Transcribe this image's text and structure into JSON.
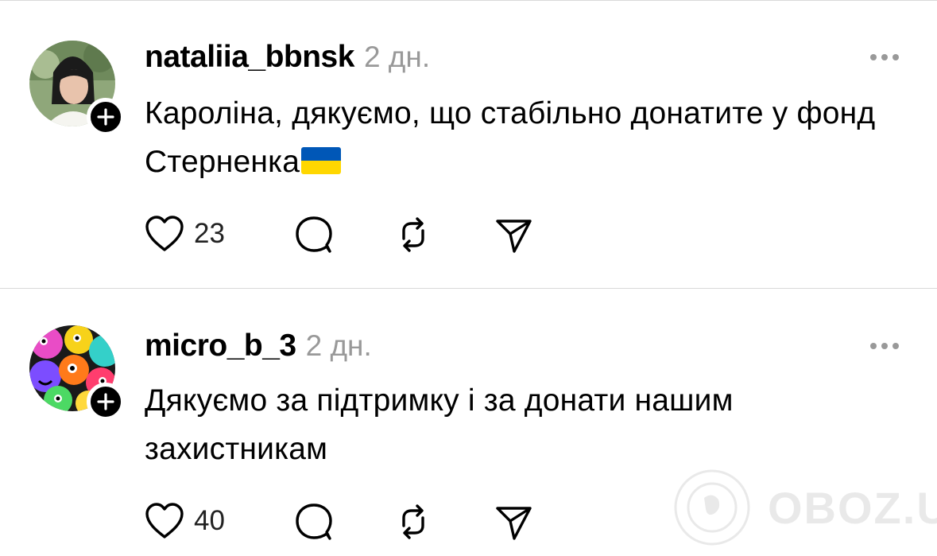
{
  "posts": [
    {
      "username": "nataliia_bbnsk",
      "time": "2 дн.",
      "text": "Кароліна, дякуємо, що стабільно донатите у фонд Стерненка",
      "likes": "23",
      "avatar_icon": "person-photo-avatar",
      "has_flag_emoji": true
    },
    {
      "username": "micro_b_3",
      "time": "2 дн.",
      "text": "Дякуємо за підтримку і за донати нашим захистникам",
      "likes": "40",
      "avatar_icon": "colorful-monsters-avatar",
      "has_flag_emoji": false
    }
  ],
  "watermark": "OBOZ.UA",
  "colors": {
    "muted": "#999999",
    "divider": "#d9d9d9",
    "flag_blue": "#0057b7",
    "flag_yellow": "#ffd700"
  }
}
